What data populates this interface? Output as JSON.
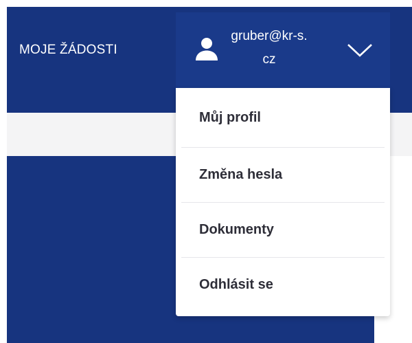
{
  "header": {
    "nav_link": "MOJE ŽÁDOSTI",
    "user": {
      "email": "gruber@kr-s.cz",
      "icon": "user-icon",
      "toggle_icon": "chevron-down-icon"
    }
  },
  "user_menu": {
    "items": [
      {
        "label": "Můj profil"
      },
      {
        "label": "Změna hesla"
      },
      {
        "label": "Dokumenty"
      },
      {
        "label": "Odhlásit se"
      }
    ]
  },
  "colors": {
    "header_bg": "#17347f",
    "user_button_bg": "#1a3a8a",
    "sub_strip_bg": "#f4f4f5",
    "menu_text": "#2e2e38",
    "menu_divider": "#e6e6ea"
  }
}
